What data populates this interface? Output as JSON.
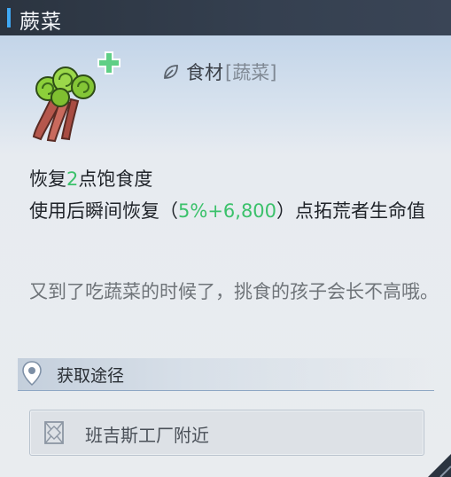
{
  "title": "蕨菜",
  "icons": {
    "item": "fern-vegetable-icon",
    "add": "green-plus-icon",
    "category": "leaf-icon",
    "location": "location-pin-icon",
    "source": "map-marker-icon"
  },
  "category": {
    "main": "食材",
    "sub": "[蔬菜]"
  },
  "effect": {
    "line1_prefix": "恢复",
    "line1_value": "2",
    "line1_suffix": "点饱食度",
    "line2_prefix": "使用后瞬间恢复（",
    "line2_value": "5%+6,800",
    "line2_suffix": "）点拓荒者生命值"
  },
  "flavor": "又到了吃蔬菜的时候了，挑食的孩子会长不高哦。",
  "acquire": {
    "label": "获取途径",
    "sources": [
      "班吉斯工厂附近"
    ]
  },
  "colors": {
    "highlight": "#3bc16b",
    "accent": "#3fa9f5",
    "titlebar": "#2b3440"
  }
}
